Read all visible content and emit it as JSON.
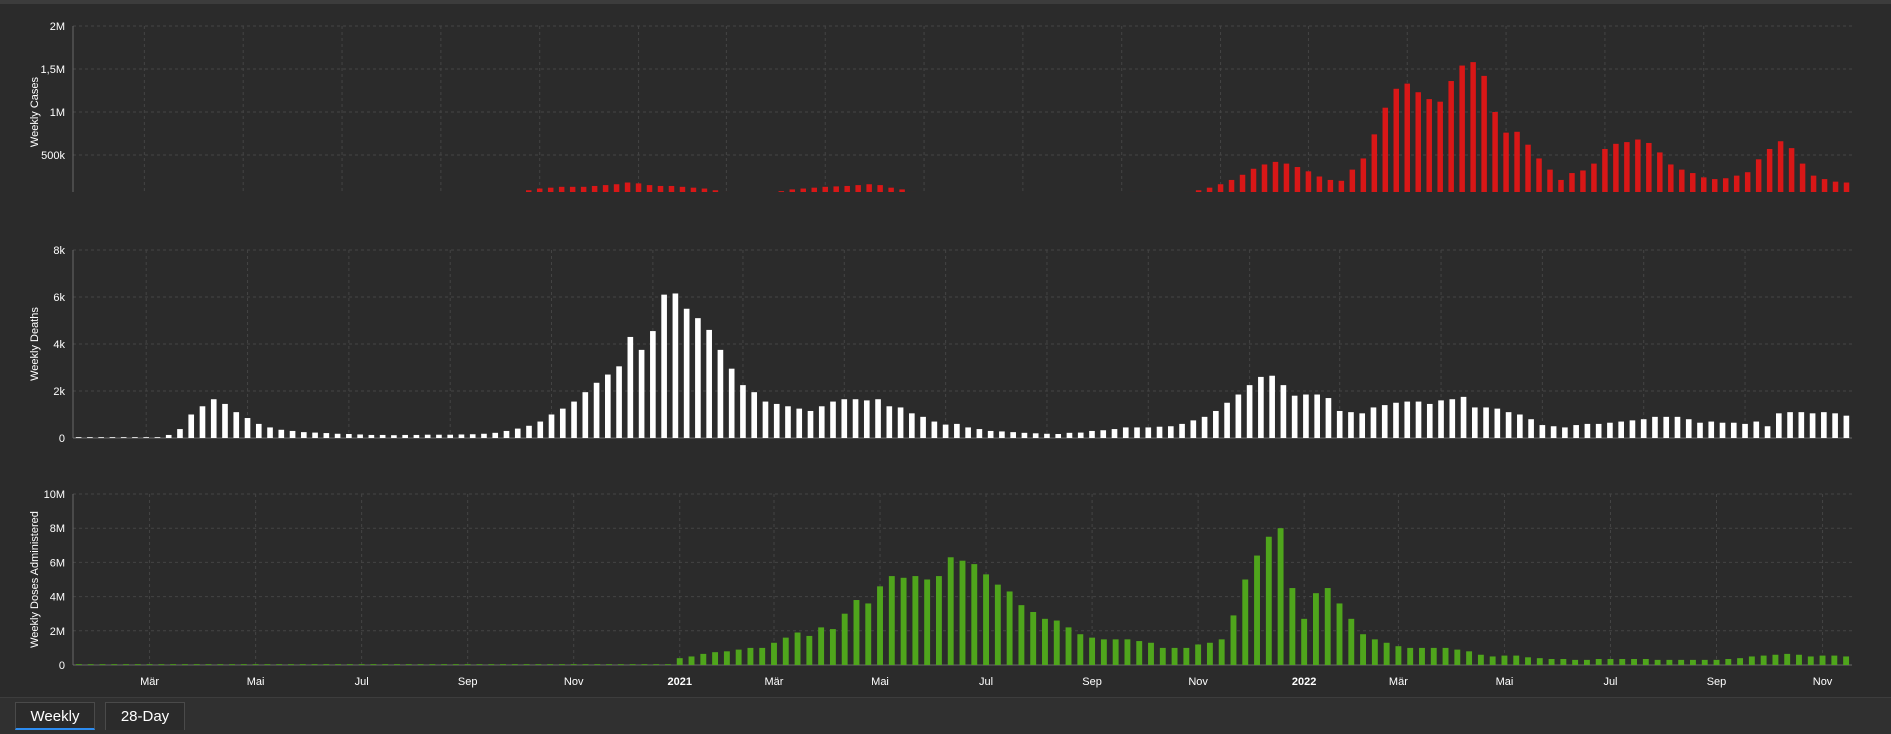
{
  "colors": {
    "cases": "#d91717",
    "deaths": "#ffffff",
    "doses": "#4fa51c",
    "active_tab": "#2d8cf0"
  },
  "tabs": [
    {
      "label": "Weekly",
      "active": true
    },
    {
      "label": "28-Day",
      "active": false
    }
  ],
  "chart_data": [
    {
      "type": "bar",
      "ylabel": "Weekly Cases",
      "ylim": [
        0,
        2000000
      ],
      "yticks": [
        "0",
        "500k",
        "1M",
        "1,5M",
        "2M"
      ],
      "ytick_values": [
        0,
        500000,
        1000000,
        1500000,
        2000000
      ],
      "color": "#d91717",
      "grid": true,
      "xticks": [
        "Mär",
        "Mai",
        "Jul",
        "Sep",
        "Nov",
        "2021",
        "Mär",
        "Mai",
        "Jul",
        "Sep",
        "Nov",
        "2022",
        "Mär",
        "Mai",
        "Jul",
        "Sep",
        "Nov"
      ],
      "xtick_weeks": [
        6,
        15,
        24,
        33,
        42,
        51,
        59,
        68,
        77,
        86,
        95,
        104,
        112,
        121,
        130,
        139,
        148
      ],
      "values": [
        0,
        0,
        0,
        0,
        0,
        0,
        0,
        0,
        5000,
        15000,
        25000,
        30000,
        25000,
        20000,
        15000,
        10000,
        10000,
        5000,
        5000,
        5000,
        0,
        0,
        0,
        0,
        0,
        0,
        0,
        0,
        5000,
        10000,
        12000,
        10000,
        10000,
        12000,
        14000,
        15000,
        16000,
        20000,
        30000,
        40000,
        60000,
        90000,
        110000,
        120000,
        130000,
        130000,
        130000,
        140000,
        150000,
        160000,
        180000,
        170000,
        150000,
        140000,
        140000,
        130000,
        120000,
        110000,
        90000,
        70000,
        60000,
        55000,
        60000,
        70000,
        80000,
        100000,
        110000,
        120000,
        130000,
        135000,
        140000,
        150000,
        160000,
        150000,
        120000,
        100000,
        70000,
        50000,
        40000,
        30000,
        20000,
        15000,
        10000,
        5000,
        5000,
        5000,
        10000,
        15000,
        20000,
        25000,
        30000,
        40000,
        45000,
        50000,
        60000,
        65000,
        70000,
        70000,
        70000,
        65000,
        60000,
        70000,
        90000,
        120000,
        160000,
        210000,
        270000,
        340000,
        390000,
        420000,
        400000,
        360000,
        310000,
        250000,
        210000,
        200000,
        330000,
        460000,
        740000,
        1050000,
        1270000,
        1330000,
        1230000,
        1150000,
        1120000,
        1360000,
        1540000,
        1580000,
        1420000,
        1000000,
        760000,
        770000,
        620000,
        460000,
        330000,
        210000,
        290000,
        320000,
        400000,
        570000,
        630000,
        650000,
        680000,
        640000,
        530000,
        390000,
        330000,
        290000,
        240000,
        220000,
        230000,
        260000,
        300000,
        450000,
        570000,
        660000,
        580000,
        400000,
        260000,
        220000,
        190000,
        180000
      ]
    },
    {
      "type": "bar",
      "ylabel": "Weekly Deaths",
      "ylim": [
        0,
        8000
      ],
      "yticks": [
        "0",
        "2k",
        "4k",
        "6k",
        "8k"
      ],
      "ytick_values": [
        0,
        2000,
        4000,
        6000,
        8000
      ],
      "color": "#ffffff",
      "grid": true,
      "xticks": [
        "Mär",
        "Mai",
        "Jul",
        "Sep",
        "Nov",
        "2021",
        "Mär",
        "Mai",
        "Jul",
        "Sep",
        "Nov",
        "2022",
        "Mär",
        "Mai",
        "Jul",
        "Sep",
        "Nov"
      ],
      "xtick_weeks": [
        6,
        15,
        24,
        33,
        42,
        51,
        59,
        68,
        77,
        86,
        95,
        104,
        112,
        121,
        130,
        139,
        148
      ],
      "values": [
        0,
        0,
        0,
        0,
        0,
        0,
        0,
        20,
        130,
        380,
        1000,
        1350,
        1650,
        1450,
        1100,
        850,
        600,
        450,
        350,
        300,
        250,
        230,
        210,
        180,
        170,
        150,
        130,
        130,
        120,
        130,
        130,
        140,
        140,
        140,
        150,
        160,
        180,
        220,
        300,
        400,
        520,
        700,
        1000,
        1250,
        1550,
        1950,
        2350,
        2700,
        3050,
        4300,
        3750,
        4550,
        6100,
        6150,
        5500,
        5100,
        4600,
        3750,
        2950,
        2250,
        1950,
        1550,
        1450,
        1350,
        1250,
        1150,
        1350,
        1550,
        1650,
        1650,
        1600,
        1650,
        1350,
        1300,
        1050,
        900,
        700,
        570,
        600,
        450,
        380,
        300,
        280,
        250,
        220,
        200,
        180,
        170,
        220,
        230,
        300,
        330,
        380,
        450,
        450,
        450,
        480,
        500,
        600,
        750,
        900,
        1150,
        1500,
        1850,
        2250,
        2600,
        2650,
        2250,
        1800,
        1850,
        1850,
        1700,
        1150,
        1100,
        1050,
        1300,
        1400,
        1500,
        1550,
        1550,
        1450,
        1600,
        1650,
        1750,
        1300,
        1300,
        1250,
        1100,
        1000,
        800,
        550,
        500,
        450,
        550,
        600,
        600,
        650,
        700,
        750,
        800,
        900,
        900,
        900,
        800,
        650,
        700,
        650,
        650,
        600,
        700,
        500,
        1050,
        1100,
        1100,
        1050,
        1100,
        1050,
        950
      ]
    },
    {
      "type": "bar",
      "ylabel": "Weekly Doses Administered",
      "ylim": [
        0,
        10000000
      ],
      "yticks": [
        "0",
        "2M",
        "4M",
        "6M",
        "8M",
        "10M"
      ],
      "ytick_values": [
        0,
        2000000,
        4000000,
        6000000,
        8000000,
        10000000
      ],
      "color": "#4fa51c",
      "grid": true,
      "xticks": [
        "Mär",
        "Mai",
        "Jul",
        "Sep",
        "Nov",
        "2021",
        "Mär",
        "Mai",
        "Jul",
        "Sep",
        "Nov",
        "2022",
        "Mär",
        "Mai",
        "Jul",
        "Sep",
        "Nov"
      ],
      "xtick_weeks": [
        6,
        15,
        24,
        33,
        42,
        51,
        59,
        68,
        77,
        86,
        95,
        104,
        112,
        121,
        130,
        139,
        148
      ],
      "values": [
        40000,
        40000,
        40000,
        40000,
        40000,
        40000,
        40000,
        40000,
        40000,
        40000,
        40000,
        40000,
        40000,
        40000,
        40000,
        40000,
        40000,
        40000,
        40000,
        40000,
        40000,
        40000,
        40000,
        40000,
        40000,
        40000,
        40000,
        40000,
        40000,
        40000,
        40000,
        40000,
        40000,
        40000,
        40000,
        40000,
        40000,
        40000,
        40000,
        40000,
        40000,
        40000,
        40000,
        40000,
        40000,
        40000,
        40000,
        40000,
        40000,
        40000,
        40000,
        400000,
        500000,
        650000,
        750000,
        800000,
        900000,
        1000000,
        1000000,
        1300000,
        1600000,
        1900000,
        1700000,
        2200000,
        2100000,
        3000000,
        3800000,
        3600000,
        4600000,
        5200000,
        5100000,
        5200000,
        5000000,
        5200000,
        6300000,
        6100000,
        5900000,
        5300000,
        4700000,
        4300000,
        3500000,
        3100000,
        2700000,
        2600000,
        2200000,
        1800000,
        1600000,
        1500000,
        1500000,
        1500000,
        1400000,
        1300000,
        1000000,
        1000000,
        1000000,
        1200000,
        1300000,
        1500000,
        2900000,
        5000000,
        6400000,
        7500000,
        8000000,
        4500000,
        2700000,
        4200000,
        4500000,
        3600000,
        2700000,
        1800000,
        1500000,
        1300000,
        1100000,
        1000000,
        1000000,
        1000000,
        1000000,
        900000,
        800000,
        600000,
        500000,
        550000,
        550000,
        450000,
        400000,
        350000,
        350000,
        300000,
        300000,
        350000,
        350000,
        350000,
        350000,
        350000,
        300000,
        300000,
        300000,
        300000,
        300000,
        300000,
        350000,
        400000,
        500000,
        550000,
        600000,
        650000,
        600000,
        500000,
        550000,
        550000,
        500000
      ]
    }
  ]
}
